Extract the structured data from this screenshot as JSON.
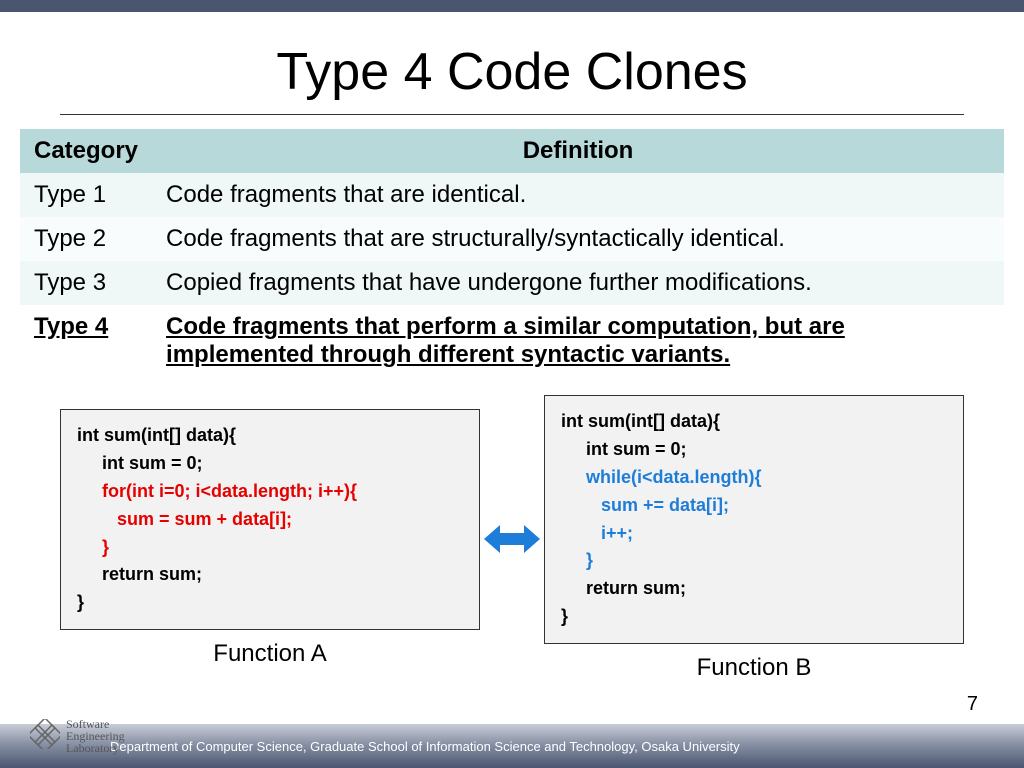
{
  "title": "Type 4 Code Clones",
  "table": {
    "headers": {
      "category": "Category",
      "definition": "Definition"
    },
    "rows": [
      {
        "cat": "Type 1",
        "def": "Code fragments that are identical."
      },
      {
        "cat": "Type 2",
        "def": "Code fragments that are structurally/syntactically identical."
      },
      {
        "cat": "Type 3",
        "def": "Copied fragments that have undergone further modifications."
      },
      {
        "cat": "Type 4",
        "def": "Code fragments that perform a similar computation, but are implemented through different syntactic variants."
      }
    ]
  },
  "codeA": {
    "l1": "int sum(int[] data){",
    "l2": "     int sum = 0;",
    "l3": "     for(int i=0; i<data.length; i++){",
    "l4": "        sum = sum + data[i];",
    "l5": "     }",
    "l6": "     return sum;",
    "l7": "}",
    "label": "Function A"
  },
  "codeB": {
    "l1": "int sum(int[] data){",
    "l2": "     int sum = 0;",
    "l3": "     while(i<data.length){",
    "l4": "        sum += data[i];",
    "l5": "        i++;",
    "l6": "     }",
    "l7": "     return sum;",
    "l8": "}",
    "label": "Function B"
  },
  "logo": {
    "l1": "Software",
    "l2": "Engineering",
    "l3": "Laboratory"
  },
  "footer": "Department of Computer Science, Graduate School of Information Science and Technology, Osaka University",
  "page": "7"
}
